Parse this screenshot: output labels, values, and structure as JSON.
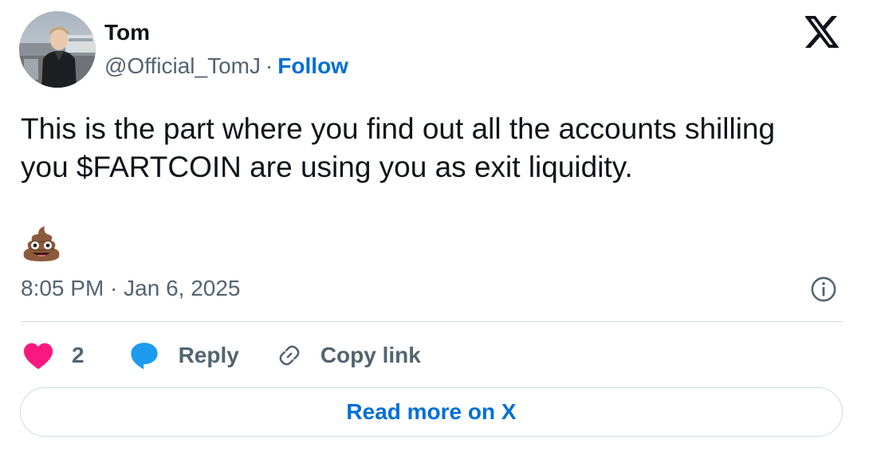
{
  "author": {
    "display_name": "Tom",
    "handle": "@Official_TomJ",
    "separator": "·",
    "follow_label": "Follow"
  },
  "tweet": {
    "lines": [
      "This is the part where you find out all the accounts shilling",
      "you $FARTCOIN are using you as exit liquidity."
    ],
    "emoji": "pile-of-poo",
    "timestamp": "8:05 PM · Jan 6, 2025"
  },
  "actions": {
    "like_count": "2",
    "reply_label": "Reply",
    "copy_link_label": "Copy link"
  },
  "read_more_label": "Read more on X",
  "colors": {
    "text": "#0f1419",
    "secondary": "#536471",
    "link": "#006fd6",
    "like": "#f91880",
    "reply": "#1d9bf0",
    "border": "#cfd9de"
  },
  "icons": [
    "x-logo-icon",
    "info-icon",
    "heart-icon",
    "reply-bubble-icon",
    "link-icon",
    "poop-emoji"
  ]
}
